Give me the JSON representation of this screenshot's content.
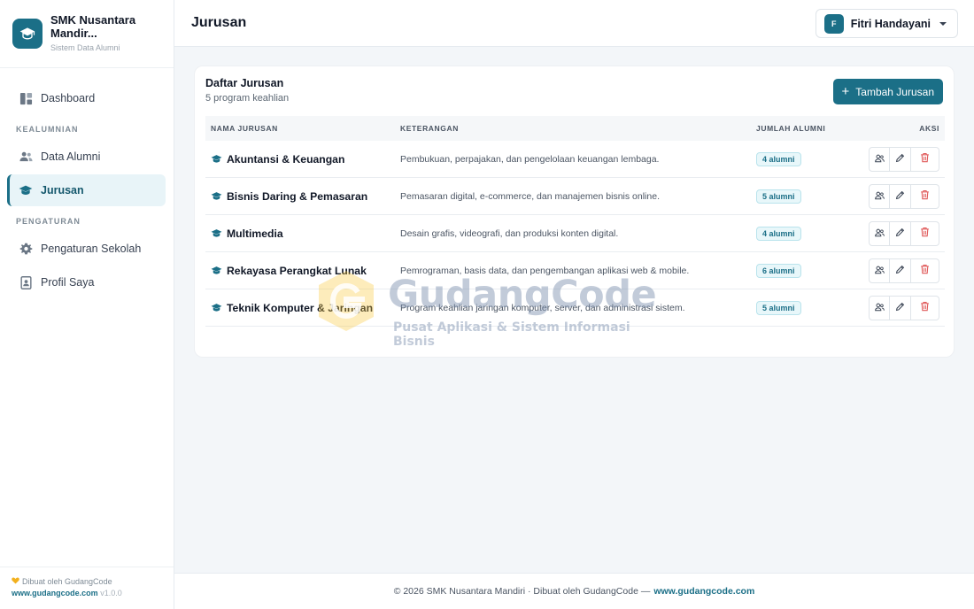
{
  "sidebar": {
    "brand_name": "SMK Nusantara Mandir...",
    "brand_sub": "Sistem Data Alumni",
    "items": [
      {
        "label": "Dashboard",
        "icon": "dashboard-icon"
      },
      {
        "section": "KEALUMNIAN"
      },
      {
        "label": "Data Alumni",
        "icon": "users-icon"
      },
      {
        "label": "Jurusan",
        "icon": "graduation-cap-icon",
        "active": true
      },
      {
        "section": "PENGATURAN"
      },
      {
        "label": "Pengaturan Sekolah",
        "icon": "gear-icon"
      },
      {
        "label": "Profil Saya",
        "icon": "id-badge-icon"
      }
    ],
    "footer_made": "Dibuat oleh GudangCode",
    "footer_url": "www.gudangcode.com",
    "footer_version": "v1.0.0"
  },
  "header": {
    "title": "Jurusan",
    "user_initial": "F",
    "user_name": "Fitri Handayani"
  },
  "card": {
    "title": "Daftar Jurusan",
    "subtitle": "5 program keahlian",
    "add_button": "Tambah Jurusan",
    "columns": [
      "NAMA JURUSAN",
      "KETERANGAN",
      "JUMLAH ALUMNI",
      "AKSI"
    ],
    "rows": [
      {
        "name": "Akuntansi & Keuangan",
        "desc": "Pembukuan, perpajakan, dan pengelolaan keuangan lembaga.",
        "alumni": "4 alumni"
      },
      {
        "name": "Bisnis Daring & Pemasaran",
        "desc": "Pemasaran digital, e-commerce, dan manajemen bisnis online.",
        "alumni": "5 alumni"
      },
      {
        "name": "Multimedia",
        "desc": "Desain grafis, videografi, dan produksi konten digital.",
        "alumni": "4 alumni"
      },
      {
        "name": "Rekayasa Perangkat Lunak",
        "desc": "Pemrograman, basis data, dan pengembangan aplikasi web & mobile.",
        "alumni": "6 alumni"
      },
      {
        "name": "Teknik Komputer & Jaringan",
        "desc": "Program keahlian jaringan komputer, server, dan administrasi sistem.",
        "alumni": "5 alumni"
      }
    ]
  },
  "watermark": {
    "title": "GudangCode",
    "subtitle": "Pusat Aplikasi & Sistem Informasi Bisnis"
  },
  "footer": {
    "text": "© 2026 SMK Nusantara Mandiri · Dibuat oleh GudangCode —",
    "link": "www.gudangcode.com"
  },
  "colors": {
    "primary": "#1b6f87",
    "danger": "#e05a5a",
    "background": "#f3f6f9"
  }
}
